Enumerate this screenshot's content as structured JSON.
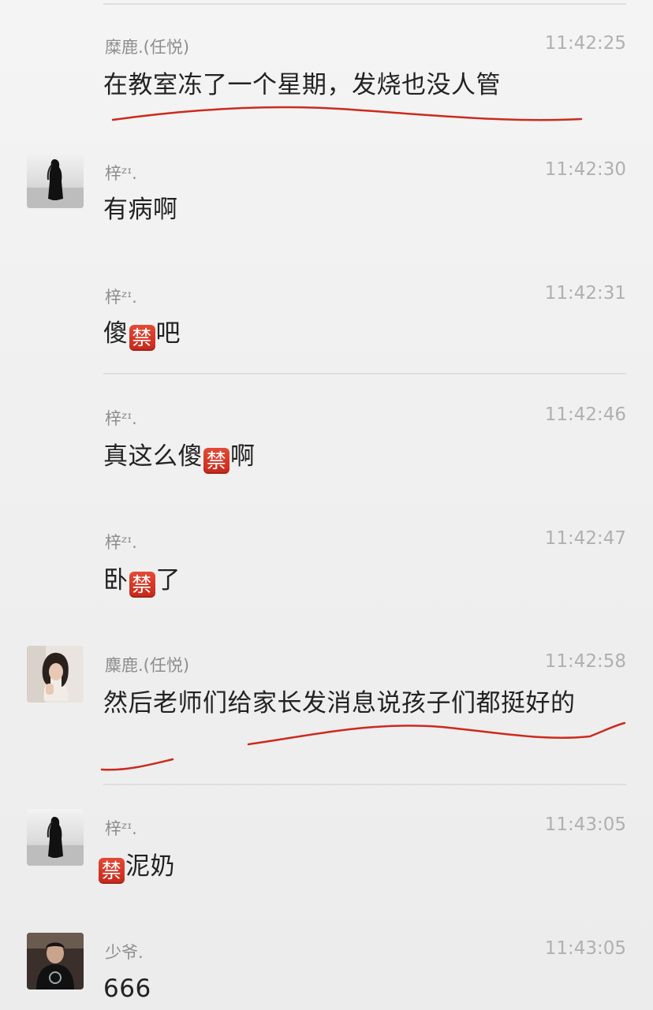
{
  "messages": [
    {
      "sender": "糜鹿.(任悦)",
      "time": "11:42:25",
      "parts": [
        {
          "text": "在教室冻了一个星期，发烧也没人管"
        }
      ]
    },
    {
      "sender": "梓ᶻᶦ.",
      "time": "11:42:30",
      "parts": [
        {
          "text": "有病啊"
        }
      ]
    },
    {
      "sender": "梓ᶻᶦ.",
      "time": "11:42:31",
      "parts": [
        {
          "text": "傻"
        },
        {
          "emoji": "禁"
        },
        {
          "text": "吧"
        }
      ]
    },
    {
      "sender": "梓ᶻᶦ.",
      "time": "11:42:46",
      "parts": [
        {
          "text": "真这么傻"
        },
        {
          "emoji": "禁"
        },
        {
          "text": "啊"
        }
      ]
    },
    {
      "sender": "梓ᶻᶦ.",
      "time": "11:42:47",
      "parts": [
        {
          "text": "卧"
        },
        {
          "emoji": "禁"
        },
        {
          "text": "了"
        }
      ]
    },
    {
      "sender": "麋鹿.(任悦)",
      "time": "11:42:58",
      "parts": [
        {
          "text": "然后老师们给家长发消息说孩子们都挺好的"
        }
      ]
    },
    {
      "sender": "梓ᶻᶦ.",
      "time": "11:43:05",
      "parts": [
        {
          "emoji": "禁"
        },
        {
          "text": "泥奶"
        }
      ]
    },
    {
      "sender": "少爷.",
      "time": "11:43:05",
      "parts": [
        {
          "text": "666"
        }
      ]
    }
  ],
  "colors": {
    "annotation_underline": "#cc2a1e",
    "censor_emoji": "#d6382a"
  },
  "icons": [
    "avatar-silhouette",
    "avatar-girl",
    "avatar-boy",
    "censor-emoji"
  ]
}
